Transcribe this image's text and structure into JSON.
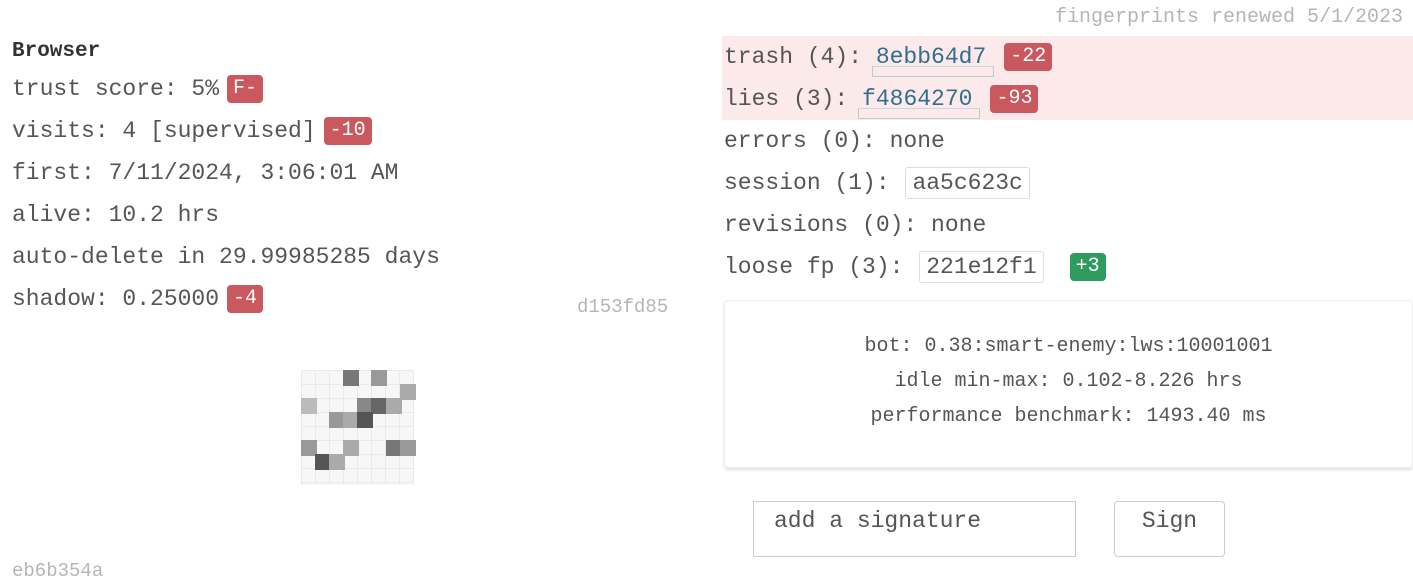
{
  "header": {
    "renewed": "fingerprints renewed 5/1/2023"
  },
  "browser": {
    "title": "Browser",
    "trust_score": "trust score: 5%",
    "trust_grade": "F-",
    "visits": "visits: 4 [supervised]",
    "visits_delta": "-10",
    "first": "first: 7/11/2024, 3:06:01 AM",
    "alive": "alive: 10.2 hrs",
    "auto_delete": "auto-delete in 29.99985285 days",
    "shadow": "shadow: 0.25000",
    "shadow_delta": "-4",
    "hash": "d153fd85",
    "footer_hash": "eb6b354a"
  },
  "signals": {
    "trash_label": "trash (4): ",
    "trash_hash": "8ebb64d7",
    "trash_delta": "-22",
    "lies_label": "lies (3): ",
    "lies_hash": "f4864270",
    "lies_delta": "-93",
    "errors": "errors (0): none",
    "session_label": "session (1): ",
    "session_hash": "aa5c623c",
    "revisions": "revisions (0): none",
    "loose_label": "loose fp (3): ",
    "loose_hash": "221e12f1",
    "loose_delta": "+3"
  },
  "info": {
    "bot": "bot: 0.38:smart-enemy:lws:10001001",
    "idle": "idle min-max: 0.102-8.226 hrs",
    "performance": "performance benchmark: 1493.40 ms"
  },
  "signature": {
    "placeholder": "add a signature",
    "button": "Sign"
  },
  "colors": {
    "bad": "#c9585f",
    "good": "#2f9b5f",
    "flag_bg": "#fce9e9",
    "link": "#2f6f8f"
  },
  "icons": {
    "identicon": "identicon-icon"
  }
}
